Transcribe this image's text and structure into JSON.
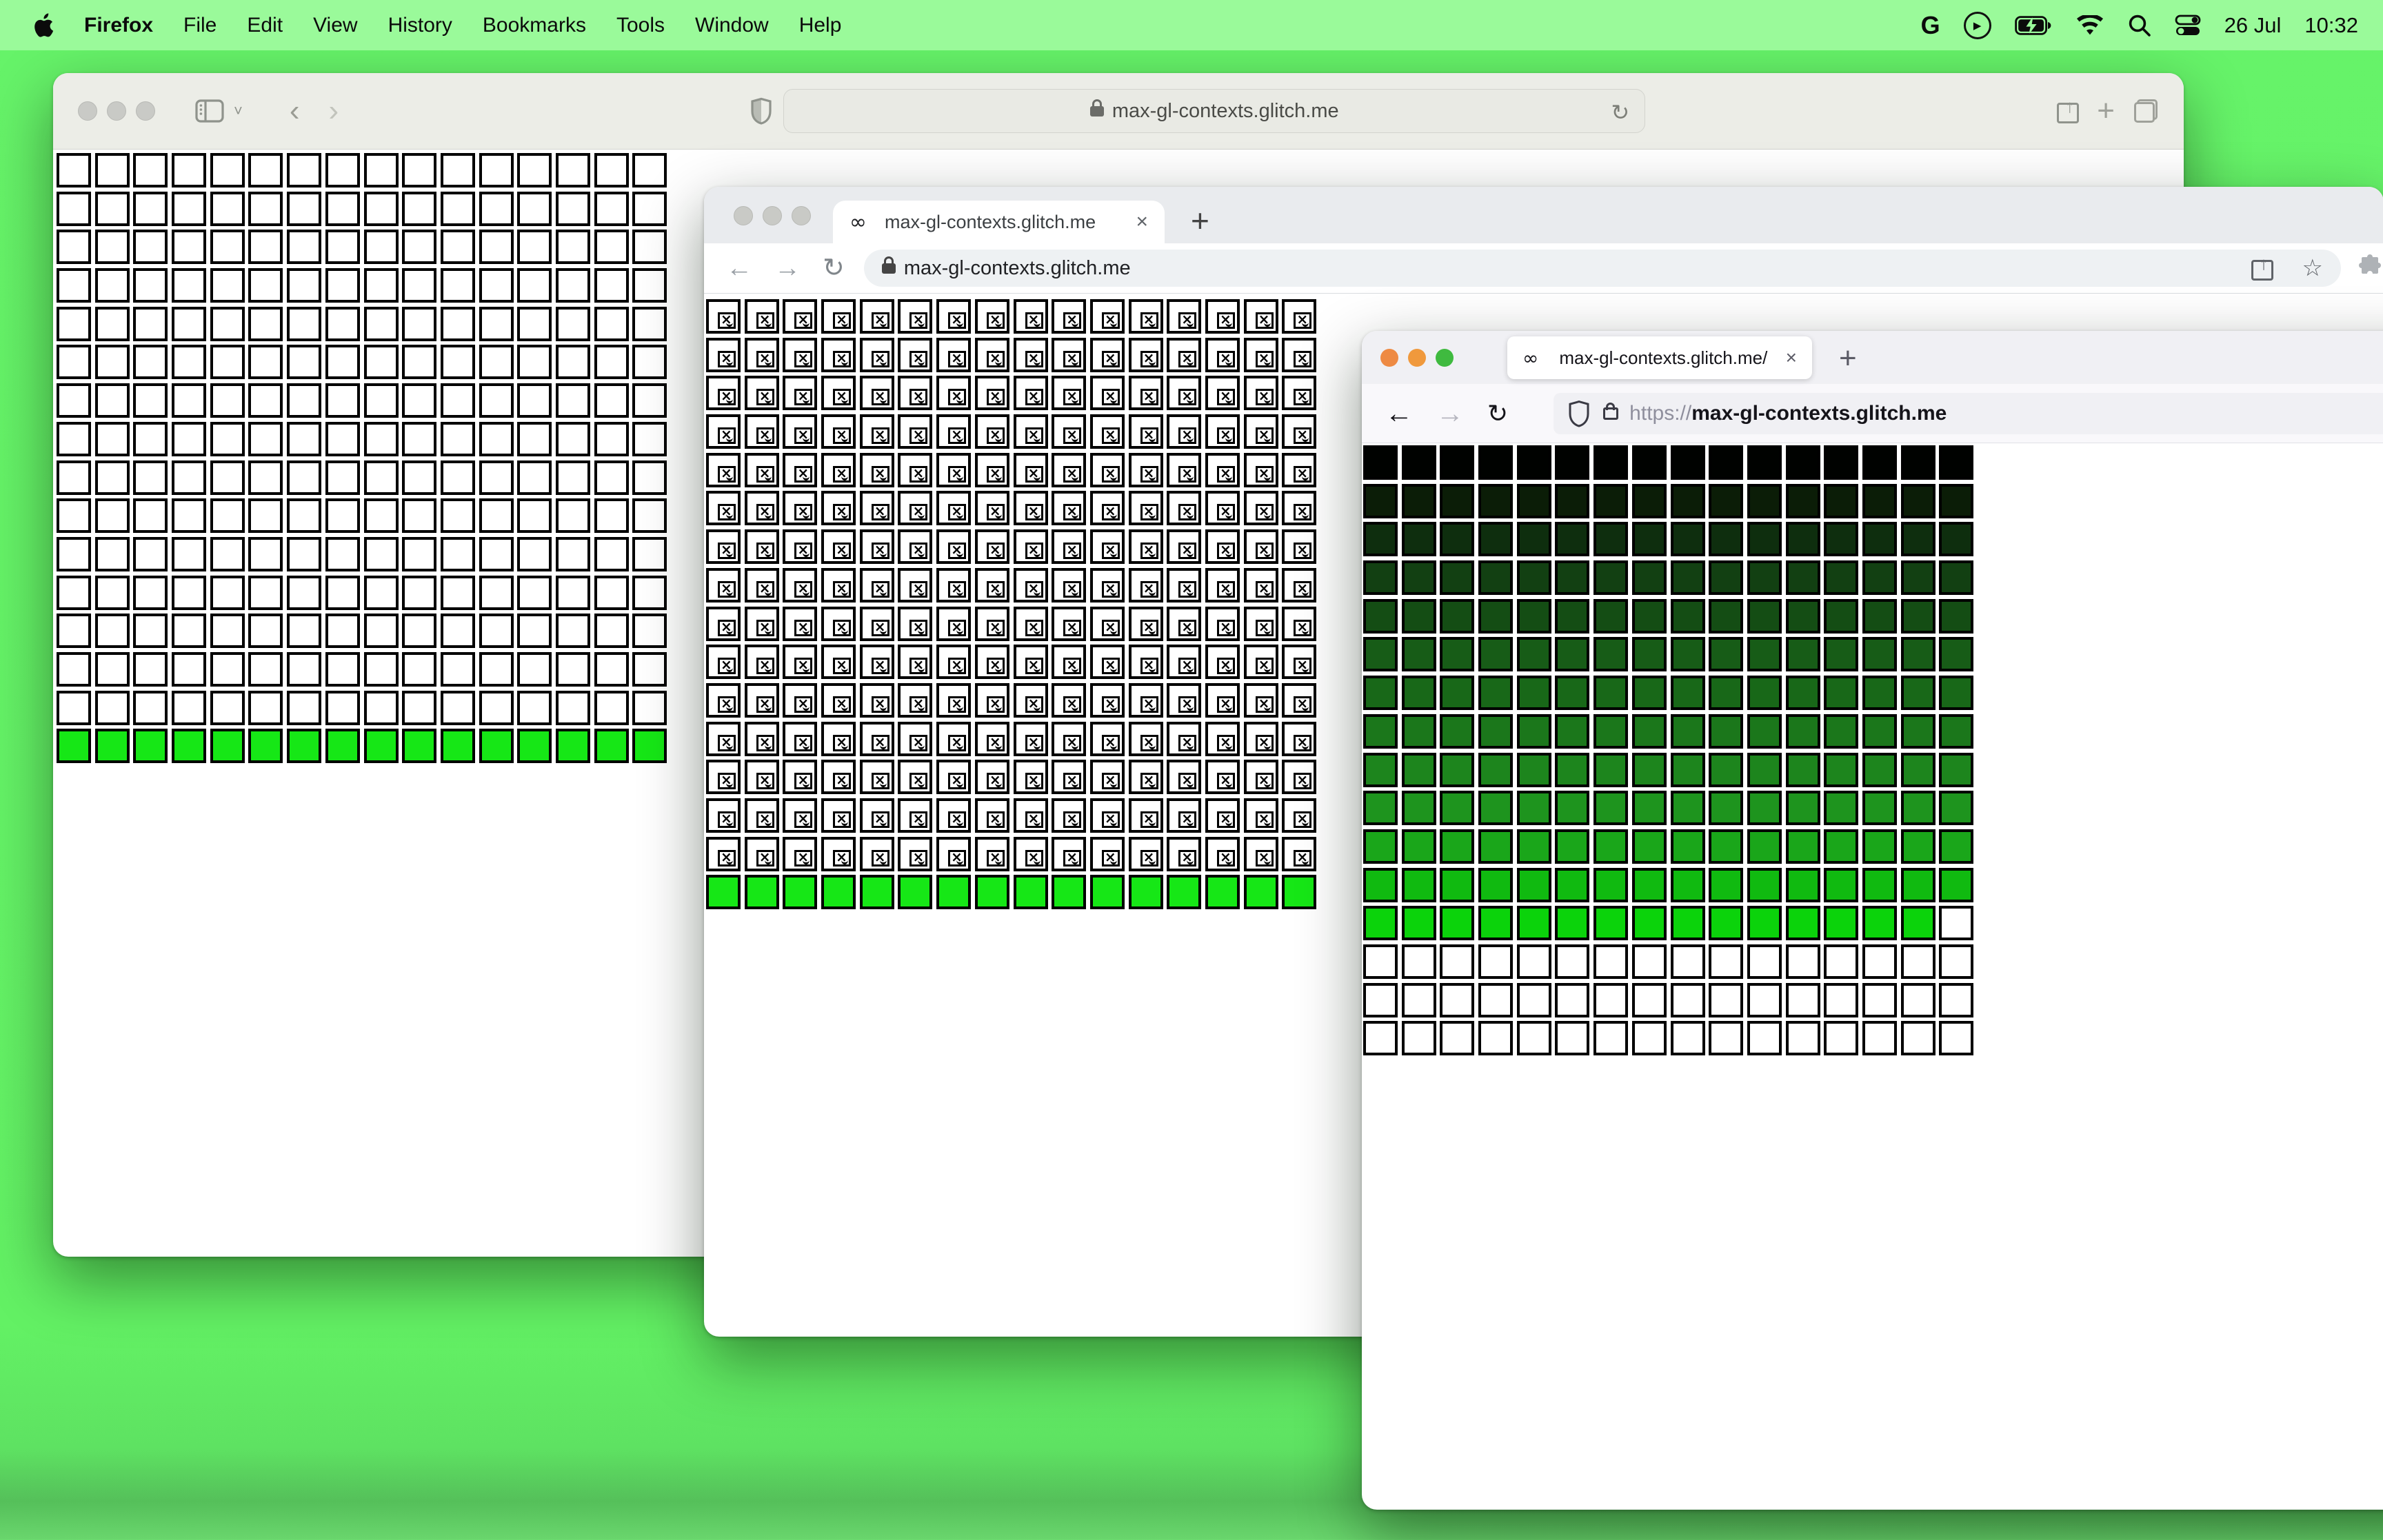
{
  "menu_bar": {
    "app_name": "Firefox",
    "items": [
      "File",
      "Edit",
      "View",
      "History",
      "Bookmarks",
      "Tools",
      "Window",
      "Help"
    ],
    "status_icons": [
      "google-g",
      "play-circle",
      "battery-charging",
      "wifi",
      "search",
      "control-center"
    ],
    "google_glyph": "G",
    "play_glyph": "▶",
    "date": "26 Jul",
    "time": "10:32"
  },
  "glyphs": {
    "infinity": "∞",
    "close": "×",
    "new_tab": "+",
    "back": "←",
    "forward": "→",
    "reload": "↻",
    "safari_back": "‹",
    "safari_forward": "›",
    "share_arrow": "↑",
    "star": "☆"
  },
  "safari_window": {
    "url": "max-gl-contexts.glitch.me",
    "toolbar_bg": "#ecede7",
    "grid": {
      "cols": 16,
      "rows": 16,
      "cell_bg": "#ffffff",
      "cell_border": "#000000",
      "last_row_color": "#16e716"
    }
  },
  "chrome_window": {
    "tab_title": "max-gl-contexts.glitch.me",
    "url": "max-gl-contexts.glitch.me",
    "tabbar_bg": "#e9ebee",
    "grid": {
      "cols": 16,
      "rows": 16,
      "cell_bg": "#ffffff",
      "cell_border": "#000000",
      "broken_icon": true,
      "last_row_color": "#16e716"
    }
  },
  "firefox_window": {
    "tab_title": "max-gl-contexts.glitch.me/",
    "url_scheme": "https://",
    "url_host": "max-gl-contexts.glitch.me",
    "tabbar_bg": "#f0f0f4",
    "traffic_lights": [
      "#ee8a43",
      "#f0993c",
      "#3fba3f"
    ],
    "grid": {
      "cols": 16,
      "rows": 16,
      "cell_border": "#000000",
      "row_colors": [
        "#000200",
        "#0b1d07",
        "#0e2e0e",
        "#124012",
        "#144d14",
        "#175c17",
        "#186818",
        "#1b771b",
        "#1d851d",
        "#1e941e",
        "#1aa61a",
        "#10ba10",
        "#0bd30b",
        "#ffffff",
        "#ffffff",
        "#ffffff"
      ],
      "white_cells": [
        [
          12,
          15
        ]
      ]
    }
  },
  "colors": {
    "desktop_green": "#63f164",
    "menu_bar_green": "#9afa9a",
    "bottom_row_green": "#16e716"
  }
}
